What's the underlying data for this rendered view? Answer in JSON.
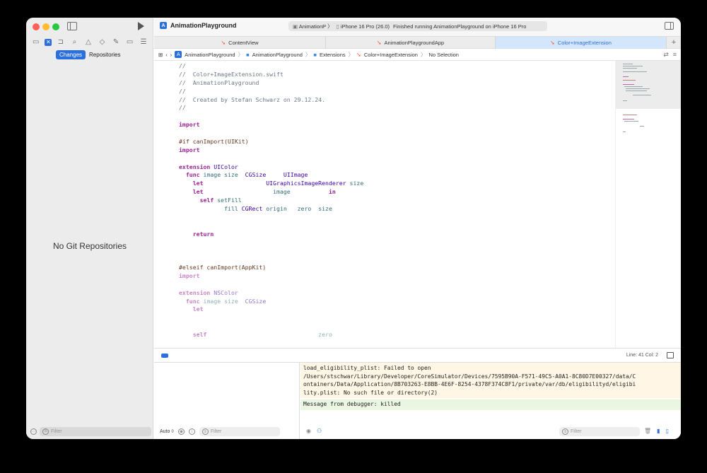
{
  "window": {
    "app_title": "AnimationPlayground",
    "status": {
      "scheme": "AnimationP",
      "device": "iPhone 16 Pro (26.0)",
      "message": "Finished running AnimationPlayground on iPhone 16 Pro"
    }
  },
  "navigator": {
    "segments": [
      "Changes",
      "Repositories"
    ],
    "empty_message": "No Git Repositories",
    "filter_placeholder": "Filter"
  },
  "tabs": [
    {
      "label": "ContentView",
      "active": false
    },
    {
      "label": "AnimationPlaygroundApp",
      "active": false
    },
    {
      "label": "Color+ImageExtension",
      "active": true
    }
  ],
  "jumpbar": [
    "AnimationPlayground",
    "AnimationPlayground",
    "Extensions",
    "Color+ImageExtension",
    "No Selection"
  ],
  "code_lines": [
    [
      {
        "t": "//",
        "c": "cm"
      }
    ],
    [
      {
        "t": "//  Color+ImageExtension.swift",
        "c": "cm"
      }
    ],
    [
      {
        "t": "//  AnimationPlayground",
        "c": "cm"
      }
    ],
    [
      {
        "t": "//",
        "c": "cm"
      }
    ],
    [
      {
        "t": "//  Created by Stefan Schwarz on 29.12.24.",
        "c": "cm"
      }
    ],
    [
      {
        "t": "//",
        "c": "cm"
      }
    ],
    [
      {
        "t": "",
        "c": ""
      }
    ],
    [
      {
        "t": "import",
        "c": "kw"
      }
    ],
    [
      {
        "t": "",
        "c": ""
      }
    ],
    [
      {
        "t": "#if canImport(UIKit)",
        "c": "pp"
      }
    ],
    [
      {
        "t": "import",
        "c": "kw"
      }
    ],
    [
      {
        "t": "",
        "c": ""
      }
    ],
    [
      {
        "t": "extension ",
        "c": "kw"
      },
      {
        "t": "UIColor",
        "c": "ty"
      }
    ],
    [
      {
        "t": "  func ",
        "c": "kw"
      },
      {
        "t": "image ",
        "c": "fn"
      },
      {
        "t": "size  ",
        "c": "fn"
      },
      {
        "t": "CGSize     ",
        "c": "ty"
      },
      {
        "t": "UIImage",
        "c": "ty"
      }
    ],
    [
      {
        "t": "    let                  ",
        "c": "kw"
      },
      {
        "t": "UIGraphicsImageRenderer ",
        "c": "ty"
      },
      {
        "t": "size",
        "c": "fn"
      }
    ],
    [
      {
        "t": "    let                    ",
        "c": "kw"
      },
      {
        "t": "image           ",
        "c": "fn"
      },
      {
        "t": "in",
        "c": "kw"
      }
    ],
    [
      {
        "t": "      self ",
        "c": "kw"
      },
      {
        "t": "setFill",
        "c": "fn"
      }
    ],
    [
      {
        "t": "             fill ",
        "c": "fn"
      },
      {
        "t": "CGRect ",
        "c": "ty"
      },
      {
        "t": "origin   ",
        "c": "fn"
      },
      {
        "t": "zero  ",
        "c": "fn"
      },
      {
        "t": "size",
        "c": "fn"
      }
    ],
    [
      {
        "t": "",
        "c": ""
      }
    ],
    [
      {
        "t": "",
        "c": ""
      }
    ],
    [
      {
        "t": "    return",
        "c": "kw"
      }
    ],
    [
      {
        "t": "",
        "c": ""
      }
    ],
    [
      {
        "t": "",
        "c": ""
      }
    ],
    [
      {
        "t": "",
        "c": ""
      }
    ],
    [
      {
        "t": "#elseif canImport(AppKit)",
        "c": "pp"
      }
    ],
    [
      {
        "t": "import",
        "c": "kw faded"
      }
    ],
    [
      {
        "t": "",
        "c": ""
      }
    ],
    [
      {
        "t": "extension ",
        "c": "kw faded"
      },
      {
        "t": "NSColor",
        "c": "ty faded"
      }
    ],
    [
      {
        "t": "  func ",
        "c": "kw faded"
      },
      {
        "t": "image ",
        "c": "fn faded"
      },
      {
        "t": "size  ",
        "c": "fn faded"
      },
      {
        "t": "CGSize",
        "c": "ty faded"
      }
    ],
    [
      {
        "t": "    let",
        "c": "kw faded"
      }
    ],
    [
      {
        "t": "",
        "c": ""
      }
    ],
    [
      {
        "t": "",
        "c": ""
      }
    ],
    [
      {
        "t": "    self                                ",
        "c": "kw faded"
      },
      {
        "t": "zero",
        "c": "fn faded"
      }
    ]
  ],
  "status_bar": {
    "position": "Line: 41  Col: 2"
  },
  "debug": {
    "scope": "Auto ◊",
    "vars_filter_placeholder": "Filter",
    "console_error": "load_eligibility_plist: Failed to open\n/Users/stschwar/Library/Developer/CoreSimulator/Devices/7595B90A-F571-49C5-A0A1-8C80D7E00327/data/C\nontainers/Data/Application/8B703263-E8BB-4E6F-8254-4378F374C8F1/private/var/db/eligibilityd/eligibi\nlity.plist: No such file or directory(2)",
    "console_message": "Message from debugger: killed",
    "console_filter_placeholder": "Filter"
  }
}
